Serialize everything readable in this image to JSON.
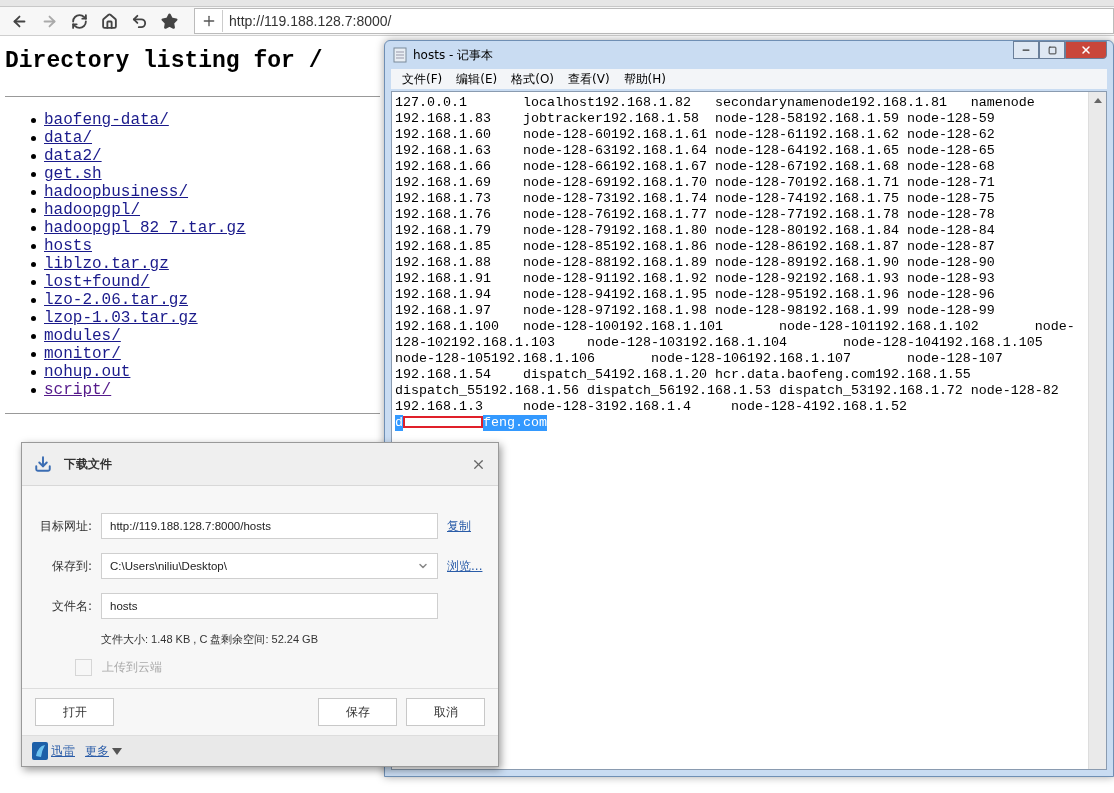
{
  "browser": {
    "toolbar": [
      {
        "kind": "back",
        "disabled": false
      },
      {
        "kind": "forward",
        "disabled": true
      },
      {
        "kind": "reload",
        "disabled": false
      },
      {
        "kind": "home",
        "disabled": false
      },
      {
        "kind": "undo",
        "disabled": false
      },
      {
        "kind": "favorite",
        "disabled": false
      }
    ],
    "url": "http://119.188.128.7:8000/"
  },
  "page": {
    "heading": "Directory listing for /",
    "links": [
      {
        "label": "baofeng-data/",
        "visited": false
      },
      {
        "label": "data/",
        "visited": false
      },
      {
        "label": "data2/",
        "visited": false
      },
      {
        "label": "get.sh",
        "visited": false
      },
      {
        "label": "hadoopbusiness/",
        "visited": false
      },
      {
        "label": "hadoopgpl/",
        "visited": false
      },
      {
        "label": "hadoopgpl_82_7.tar.gz",
        "visited": false
      },
      {
        "label": "hosts",
        "visited": false
      },
      {
        "label": "liblzo.tar.gz",
        "visited": false
      },
      {
        "label": "lost+found/",
        "visited": false
      },
      {
        "label": "lzo-2.06.tar.gz",
        "visited": false
      },
      {
        "label": "lzop-1.03.tar.gz",
        "visited": false
      },
      {
        "label": "modules/",
        "visited": false
      },
      {
        "label": "monitor/",
        "visited": false
      },
      {
        "label": "nohup.out",
        "visited": false
      },
      {
        "label": "script/",
        "visited": true
      }
    ]
  },
  "notepad": {
    "title": "hosts - 记事本",
    "menu": [
      "文件(F)",
      "编辑(E)",
      "格式(O)",
      "查看(V)",
      "帮助(H)"
    ],
    "lines": [
      {
        "kind": "text",
        "text": "127.0.0.1       localhost192.168.1.82   secondarynamenode192.168.1.81   namenode"
      },
      {
        "kind": "text",
        "text": "192.168.1.83    jobtracker192.168.1.58  node-128-58192.168.1.59 node-128-59"
      },
      {
        "kind": "text",
        "text": "192.168.1.60    node-128-60192.168.1.61 node-128-61192.168.1.62 node-128-62"
      },
      {
        "kind": "text",
        "text": "192.168.1.63    node-128-63192.168.1.64 node-128-64192.168.1.65 node-128-65"
      },
      {
        "kind": "text",
        "text": "192.168.1.66    node-128-66192.168.1.67 node-128-67192.168.1.68 node-128-68"
      },
      {
        "kind": "text",
        "text": "192.168.1.69    node-128-69192.168.1.70 node-128-70192.168.1.71 node-128-71"
      },
      {
        "kind": "text",
        "text": "192.168.1.73    node-128-73192.168.1.74 node-128-74192.168.1.75 node-128-75"
      },
      {
        "kind": "text",
        "text": "192.168.1.76    node-128-76192.168.1.77 node-128-77192.168.1.78 node-128-78"
      },
      {
        "kind": "text",
        "text": "192.168.1.79    node-128-79192.168.1.80 node-128-80192.168.1.84 node-128-84"
      },
      {
        "kind": "text",
        "text": "192.168.1.85    node-128-85192.168.1.86 node-128-86192.168.1.87 node-128-87"
      },
      {
        "kind": "text",
        "text": "192.168.1.88    node-128-88192.168.1.89 node-128-89192.168.1.90 node-128-90"
      },
      {
        "kind": "text",
        "text": "192.168.1.91    node-128-91192.168.1.92 node-128-92192.168.1.93 node-128-93"
      },
      {
        "kind": "text",
        "text": "192.168.1.94    node-128-94192.168.1.95 node-128-95192.168.1.96 node-128-96"
      },
      {
        "kind": "text",
        "text": "192.168.1.97    node-128-97192.168.1.98 node-128-98192.168.1.99 node-128-99"
      },
      {
        "kind": "text",
        "text": "192.168.1.100   node-128-100192.168.1.101       node-128-101192.168.1.102       node-"
      },
      {
        "kind": "text",
        "text": "128-102192.168.1.103    node-128-103192.168.1.104       node-128-104192.168.1.105"
      },
      {
        "kind": "text",
        "text": "node-128-105192.168.1.106       node-128-106192.168.1.107       node-128-107"
      },
      {
        "kind": "text",
        "text": "192.168.1.54    dispatch_54192.168.1.20 hcr.data.baofeng.com192.168.1.55"
      },
      {
        "kind": "text",
        "text": "dispatch_55192.168.1.56 dispatch_56192.168.1.53 dispatch_53192.168.1.72 node-128-82"
      },
      {
        "kind": "text",
        "text": "192.168.1.3     node-128-3192.168.1.4     node-128-4192.168.1.52"
      },
      {
        "kind": "redacted",
        "before": "d",
        "after": "feng.com",
        "selected": true
      }
    ]
  },
  "download_dialog": {
    "title": "下载文件",
    "fields": [
      {
        "kind": "text",
        "label": "目标网址:",
        "value": "http://119.188.128.7:8000/hosts",
        "link": "复制"
      },
      {
        "kind": "dropdown",
        "label": "保存到:",
        "value": "C:\\Users\\niliu\\Desktop\\",
        "link": "浏览..."
      },
      {
        "kind": "text",
        "label": "文件名:",
        "value": "hosts"
      }
    ],
    "info": "文件大小: 1.48 KB , C 盘剩余空间: 52.24 GB",
    "upload": {
      "label": "上传到云端",
      "checked": false,
      "disabled": true
    },
    "buttons": [
      {
        "label": "打开",
        "kind": "left"
      },
      {
        "label": "保存",
        "kind": "right"
      },
      {
        "label": "取消",
        "kind": "right"
      }
    ],
    "footer": {
      "brand": "迅雷",
      "more": "更多"
    }
  }
}
